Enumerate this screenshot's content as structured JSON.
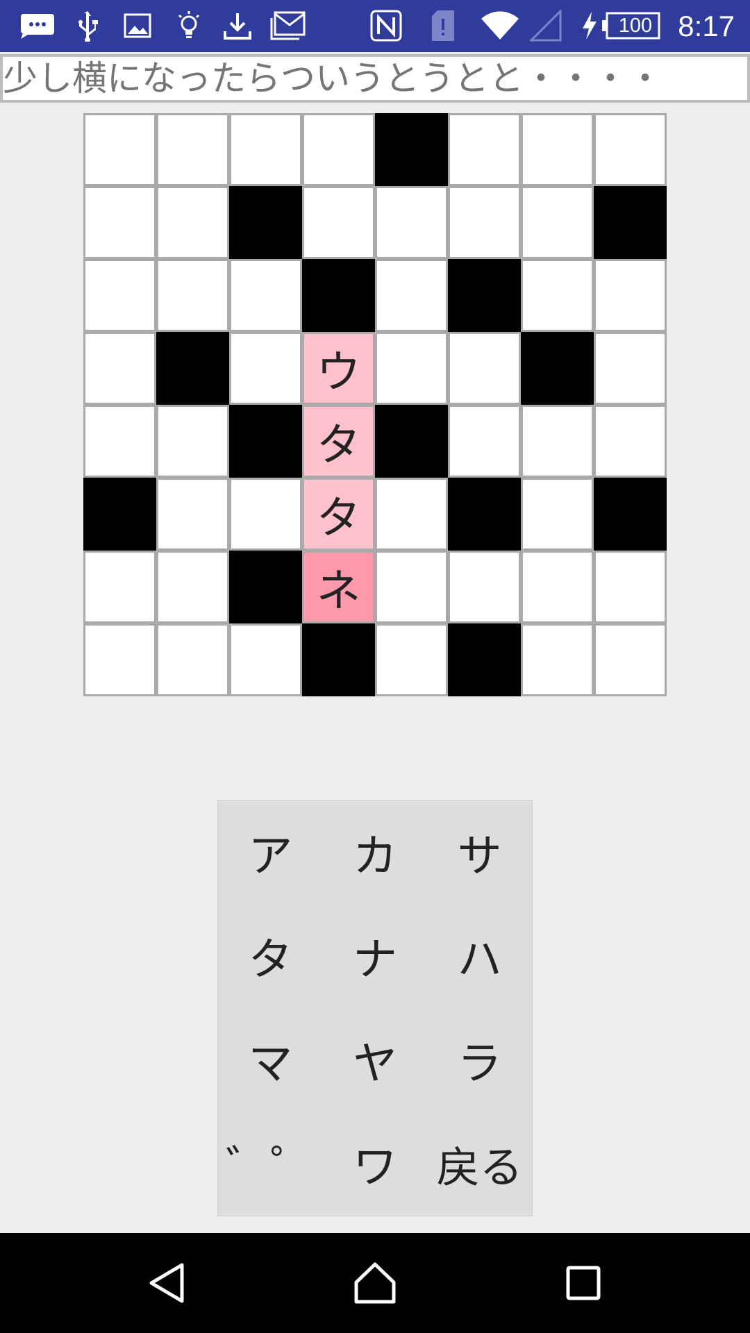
{
  "status_bar": {
    "time": "8:17",
    "battery": "100",
    "icons_left": [
      "chat-bubble-icon",
      "usb-icon",
      "image-icon",
      "lightbulb-icon",
      "download-icon",
      "gmail-icon"
    ],
    "icons_right": [
      "nfc-icon",
      "sim-alert-icon",
      "wifi-icon",
      "signal-icon",
      "charging-icon",
      "battery-icon"
    ]
  },
  "clue": {
    "text": "少し横になったらついうとうとと・・・・"
  },
  "grid": {
    "rows": 8,
    "cols": 8,
    "cells": [
      [
        "",
        "",
        "",
        "",
        "#",
        "",
        "",
        ""
      ],
      [
        "",
        "",
        "#",
        "",
        "",
        "",
        "",
        "#"
      ],
      [
        "",
        "",
        "",
        "#",
        "",
        "#",
        "",
        ""
      ],
      [
        "",
        "#",
        "",
        "ウ",
        "",
        "",
        "#",
        ""
      ],
      [
        "",
        "",
        "#",
        "タ",
        "#",
        "",
        "",
        ""
      ],
      [
        "#",
        "",
        "",
        "タ",
        "",
        "#",
        "",
        "#"
      ],
      [
        "",
        "",
        "#",
        "ネ",
        "",
        "",
        "",
        ""
      ],
      [
        "",
        "",
        "",
        "#",
        "",
        "#",
        "",
        ""
      ]
    ],
    "highlight": [
      [
        3,
        3
      ],
      [
        4,
        3
      ],
      [
        5,
        3
      ]
    ],
    "current": [
      6,
      3
    ]
  },
  "keypad": {
    "keys": [
      "ア",
      "カ",
      "サ",
      "タ",
      "ナ",
      "ハ",
      "マ",
      "ヤ",
      "ラ",
      "゛゜",
      "ワ",
      "戻る"
    ]
  },
  "nav_bar": {
    "buttons": [
      "back-icon",
      "home-icon",
      "recents-icon"
    ]
  },
  "colors": {
    "status_bar": "#2f3c9c",
    "highlight": "#ffc2cd",
    "current": "#ff99ac",
    "black_cell": "#000000"
  }
}
